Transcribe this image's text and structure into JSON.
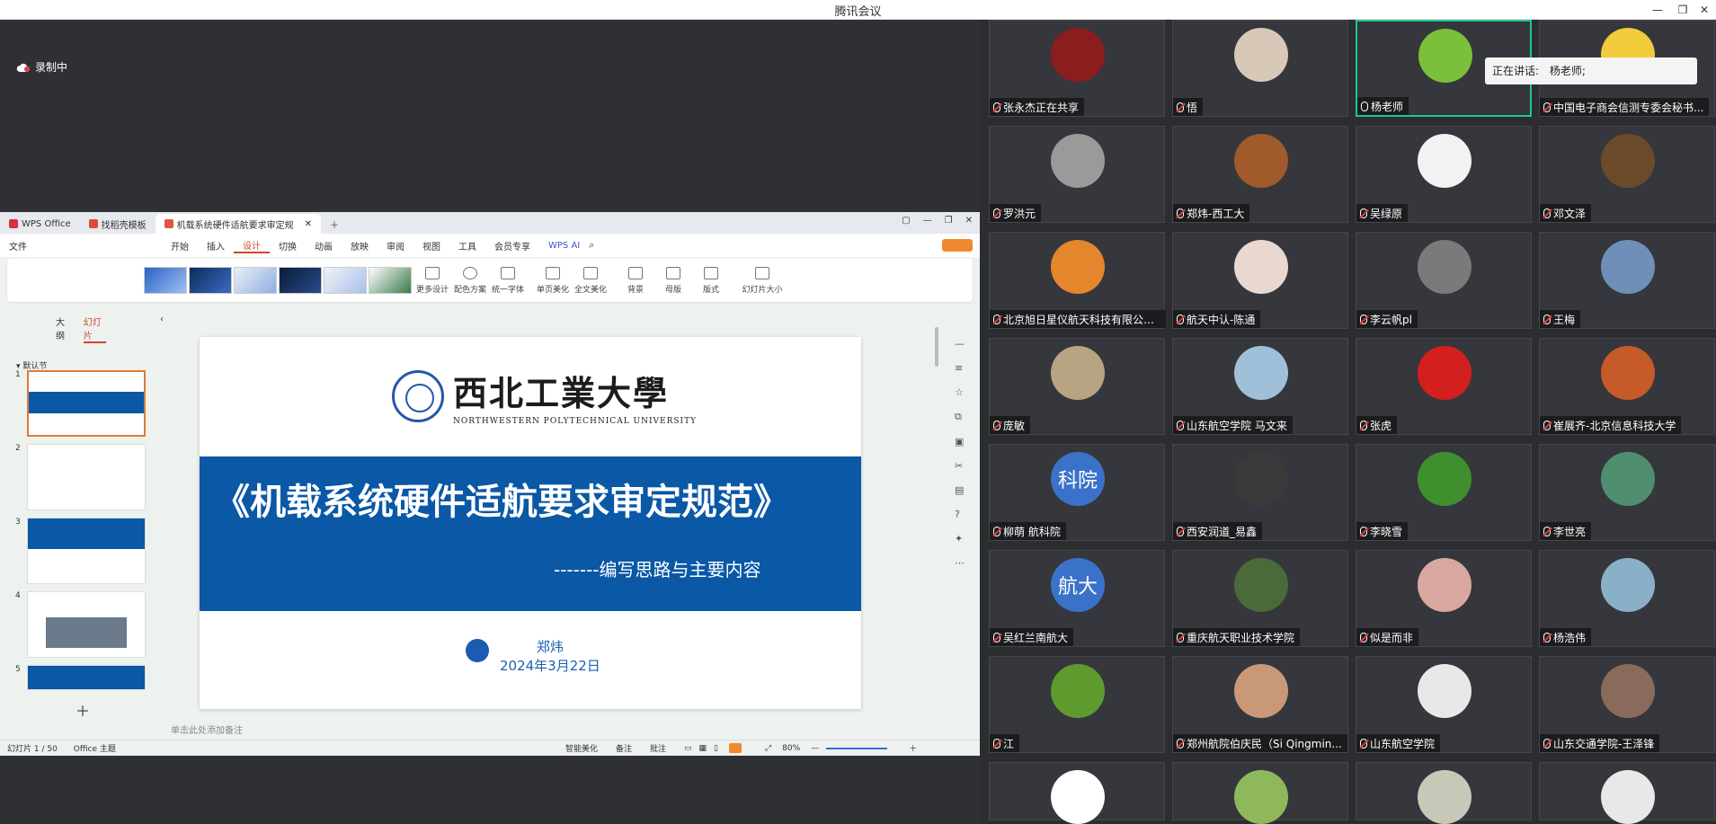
{
  "window": {
    "title": "腾讯会议"
  },
  "recording": {
    "label": "录制中"
  },
  "wps": {
    "tabs": [
      {
        "label": "WPS Office"
      },
      {
        "label": "找稻壳模板"
      },
      {
        "label": "机载系统硬件适航要求审定规"
      }
    ],
    "file_menu": "文件",
    "menu": [
      "开始",
      "插入",
      "设计",
      "切换",
      "动画",
      "放映",
      "审阅",
      "视图",
      "工具",
      "会员专享"
    ],
    "wps_ai": "WPS AI",
    "ribbon": {
      "more_design": "更多设计",
      "color_scheme": "配色方案",
      "unify_font": "统一字体",
      "single_beautify": "单页美化",
      "full_beautify": "全文美化",
      "background": "背景",
      "master": "母版",
      "format": "版式",
      "slide_size": "幻灯片大小"
    },
    "side_tabs": {
      "outline": "大纲",
      "slides": "幻灯片"
    },
    "section": "默认节",
    "slide_numbers": [
      "1",
      "2",
      "3",
      "4",
      "5"
    ],
    "notes_placeholder": "单击此处添加备注",
    "status": {
      "slide_index": "幻灯片 1 / 50",
      "theme": "Office 主题",
      "smart_beautify": "智能美化",
      "notes": "备注",
      "comments": "批注",
      "zoom": "80%"
    }
  },
  "slide": {
    "school_cn": "西北工業大學",
    "school_en": "NORTHWESTERN POLYTECHNICAL UNIVERSITY",
    "title": "《机载系统硬件适航要求审定规范》",
    "subtitle": "-------编写思路与主要内容",
    "author": "郑炜",
    "date": "2024年3月22日"
  },
  "meeting": {
    "speaking_label": "正在讲话:",
    "speaking_name": "杨老师;",
    "participants": [
      {
        "name": "张永杰正在共享",
        "avatar_color": "#8b1d1d"
      },
      {
        "name": "悟",
        "avatar_color": "#d7c8b8"
      },
      {
        "name": "杨老师",
        "avatar_color": "#7bbf3a",
        "speaking": true
      },
      {
        "name": "中国电子商会信测专委会秘书...",
        "avatar_color": "#f2cb3a"
      },
      {
        "name": "罗洪元",
        "avatar_color": "#9a9a9a"
      },
      {
        "name": "郑炜-西工大",
        "avatar_color": "#a05a2c"
      },
      {
        "name": "吴绿原",
        "avatar_color": "#f2f2f2"
      },
      {
        "name": "邓文泽",
        "avatar_color": "#6b4a2a"
      },
      {
        "name": "北京旭日星仪航天科技有限公司...",
        "avatar_color": "#e4862b"
      },
      {
        "name": "航天中认-陈通",
        "avatar_color": "#e8d8d0"
      },
      {
        "name": "李云帆pl",
        "avatar_color": "#7a7a7a"
      },
      {
        "name": "王梅",
        "avatar_color": "#6f8fb8"
      },
      {
        "name": "庞敏",
        "avatar_color": "#b8a482"
      },
      {
        "name": "山东航空学院 马文来",
        "avatar_color": "#9fc0d8"
      },
      {
        "name": "张虎",
        "avatar_color": "#d41f1f"
      },
      {
        "name": "崔展齐-北京信息科技大学",
        "avatar_color": "#c65a28"
      },
      {
        "name": "柳萌 航科院",
        "avatar_text": "科院"
      },
      {
        "name": "西安润道_易鑫",
        "avatar_color": "#3a3a3a"
      },
      {
        "name": "李晓雪",
        "avatar_color": "#3f8f2f"
      },
      {
        "name": "李世亮",
        "avatar_color": "#4f8f6f"
      },
      {
        "name": "吴红兰南航大",
        "avatar_text": "航大"
      },
      {
        "name": "重庆航天职业技术学院",
        "avatar_color": "#4a6a3a"
      },
      {
        "name": "似是而非",
        "avatar_color": "#d8a8a0"
      },
      {
        "name": "杨浩伟",
        "avatar_color": "#8ab0c8"
      },
      {
        "name": "江",
        "avatar_color": "#5f9a2f"
      },
      {
        "name": "郑州航院伯庆民（Si Qingmin...",
        "avatar_color": "#c89878"
      },
      {
        "name": "山东航空学院",
        "avatar_color": "#e8e8e8"
      },
      {
        "name": "山东交通学院-王泽锋",
        "avatar_color": "#8a6a5a"
      },
      {
        "name": "",
        "avatar_color": "#ffffff"
      },
      {
        "name": "",
        "avatar_color": "#8fb85a"
      },
      {
        "name": "",
        "avatar_color": "#c8c8b8"
      },
      {
        "name": "",
        "avatar_color": "#e8e8e8"
      }
    ]
  }
}
